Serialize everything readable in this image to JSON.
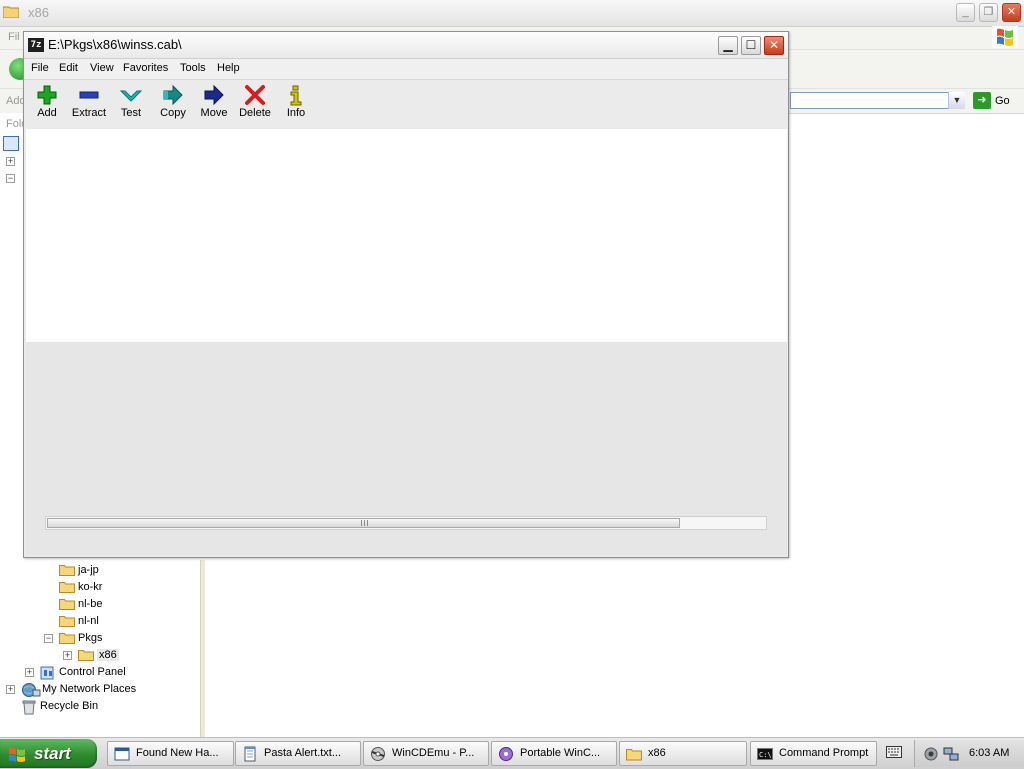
{
  "background_window": {
    "title": "x86",
    "menu_first": "Fil",
    "address_label": "Add",
    "folders_label": "Fold",
    "go_label": "Go",
    "tree": [
      {
        "label": "ja-jp",
        "indent": 2,
        "expander": "",
        "icon": "folder-icon"
      },
      {
        "label": "ko-kr",
        "indent": 2,
        "expander": "",
        "icon": "folder-icon"
      },
      {
        "label": "nl-be",
        "indent": 2,
        "expander": "",
        "icon": "folder-icon"
      },
      {
        "label": "nl-nl",
        "indent": 2,
        "expander": "",
        "icon": "folder-icon"
      },
      {
        "label": "Pkgs",
        "indent": 2,
        "expander": "−",
        "icon": "folder-icon"
      },
      {
        "label": "x86",
        "indent": 3,
        "expander": "+",
        "icon": "folder-icon",
        "selected": true
      },
      {
        "label": "Control Panel",
        "indent": 1,
        "expander": "+",
        "icon": "control-panel-icon"
      },
      {
        "label": "My Network Places",
        "indent": 0,
        "expander": "+",
        "icon": "network-places-icon"
      },
      {
        "label": "Recycle Bin",
        "indent": 0,
        "expander": "",
        "icon": "recycle-bin-icon"
      }
    ]
  },
  "zip_window": {
    "title": "E:\\Pkgs\\x86\\winss.cab\\",
    "icon_text": "7z",
    "menu": [
      "File",
      "Edit",
      "View",
      "Favorites",
      "Tools",
      "Help"
    ],
    "toolbar": [
      {
        "label": "Add",
        "icon": "add-icon",
        "color": "#1fa51f"
      },
      {
        "label": "Extract",
        "icon": "extract-icon",
        "color": "#2b3fb8"
      },
      {
        "label": "Test",
        "icon": "test-icon",
        "color": "#18b6b6"
      },
      {
        "label": "Copy",
        "icon": "copy-icon",
        "color": "#17888a"
      },
      {
        "label": "Move",
        "icon": "move-icon",
        "color": "#1c2a8c"
      },
      {
        "label": "Delete",
        "icon": "delete-icon",
        "color": "#d21f1f"
      },
      {
        "label": "Info",
        "icon": "info-icon",
        "color": "#d6c400"
      }
    ]
  },
  "taskbar": {
    "start_label": "start",
    "buttons": [
      {
        "label": "Found New Ha...",
        "icon": "window-icon"
      },
      {
        "label": "Pasta Alert.txt...",
        "icon": "notepad-icon"
      },
      {
        "label": "WinCDEmu - P...",
        "icon": "wincdemu-icon"
      },
      {
        "label": "Portable WinC...",
        "icon": "portable-icon"
      },
      {
        "label": "x86",
        "icon": "folder-icon"
      },
      {
        "label": "Command Prompt",
        "icon": "cmd-icon"
      }
    ],
    "clock": "6:03 AM"
  }
}
